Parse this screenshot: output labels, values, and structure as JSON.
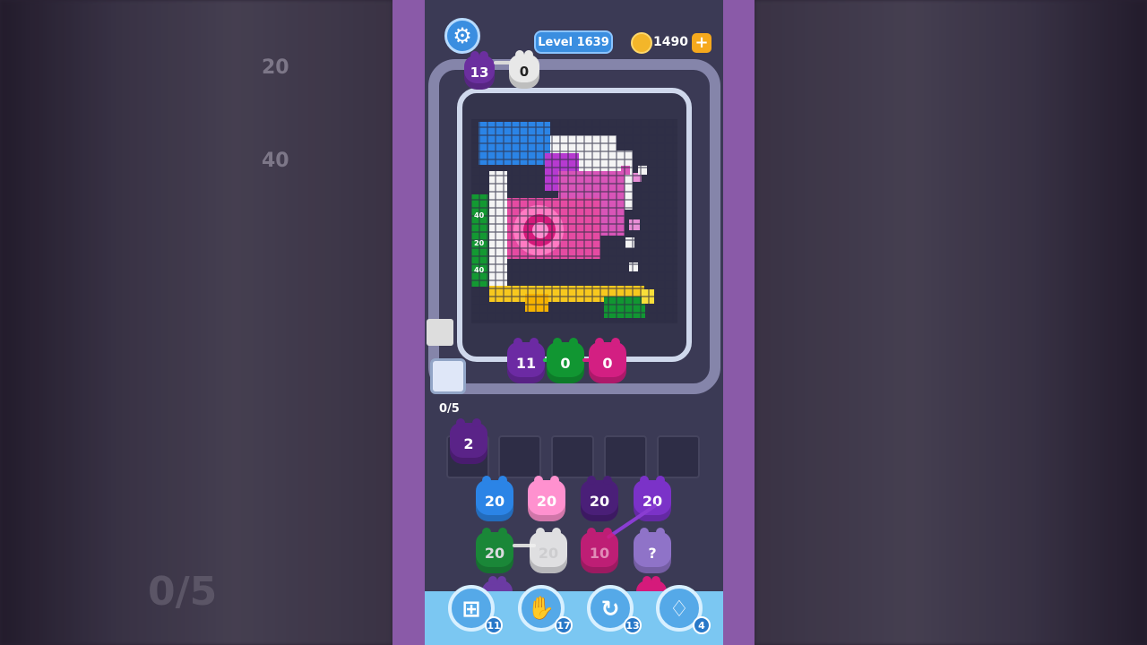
{
  "hud": {
    "level_label": "Level 1639",
    "coins": "1490",
    "settings_icon": "gear-icon",
    "coin_icon": "coin-icon",
    "plus_icon": "plus-icon"
  },
  "top_pigs": [
    {
      "label": "13",
      "color": "#6b2f9f"
    },
    {
      "label": "0",
      "color": "#e8e8e8"
    }
  ],
  "board": {
    "side_numbers": [
      "40",
      "20",
      "40"
    ],
    "counter": "0/5"
  },
  "conveyor_pigs": [
    {
      "label": "11",
      "color": "#6c2aa3"
    },
    {
      "label": "0",
      "color": "#119632"
    },
    {
      "label": "0",
      "color": "#d31f82"
    }
  ],
  "queue": [
    {
      "label": "2",
      "color": "#5a2388"
    }
  ],
  "grid_pigs": [
    {
      "label": "20",
      "color": "#2b84e6"
    },
    {
      "label": "20",
      "color": "#ff91cf"
    },
    {
      "label": "20",
      "color": "#4a1f78"
    },
    {
      "label": "20",
      "color": "#7b32c8"
    },
    {
      "label": "20",
      "color": "#139932"
    },
    {
      "label": "20",
      "color": "#f1f1f1"
    },
    {
      "label": "10",
      "color": "#d51a7b"
    },
    {
      "label": "?",
      "color": "#8f73c8"
    }
  ],
  "bottom_peeks": [
    {
      "label": "?",
      "color": "#6b3ba3"
    },
    {
      "label": "",
      "color": "#d51a7b"
    }
  ],
  "tools": [
    {
      "icon": "add-slot-icon",
      "count": "11"
    },
    {
      "icon": "hand-icon",
      "count": "17"
    },
    {
      "icon": "refresh-icon",
      "count": "13"
    },
    {
      "icon": "bunny-icon",
      "count": "4"
    }
  ],
  "background_text": {
    "counter": "0/5",
    "number_20": "20",
    "number_40": "40"
  }
}
